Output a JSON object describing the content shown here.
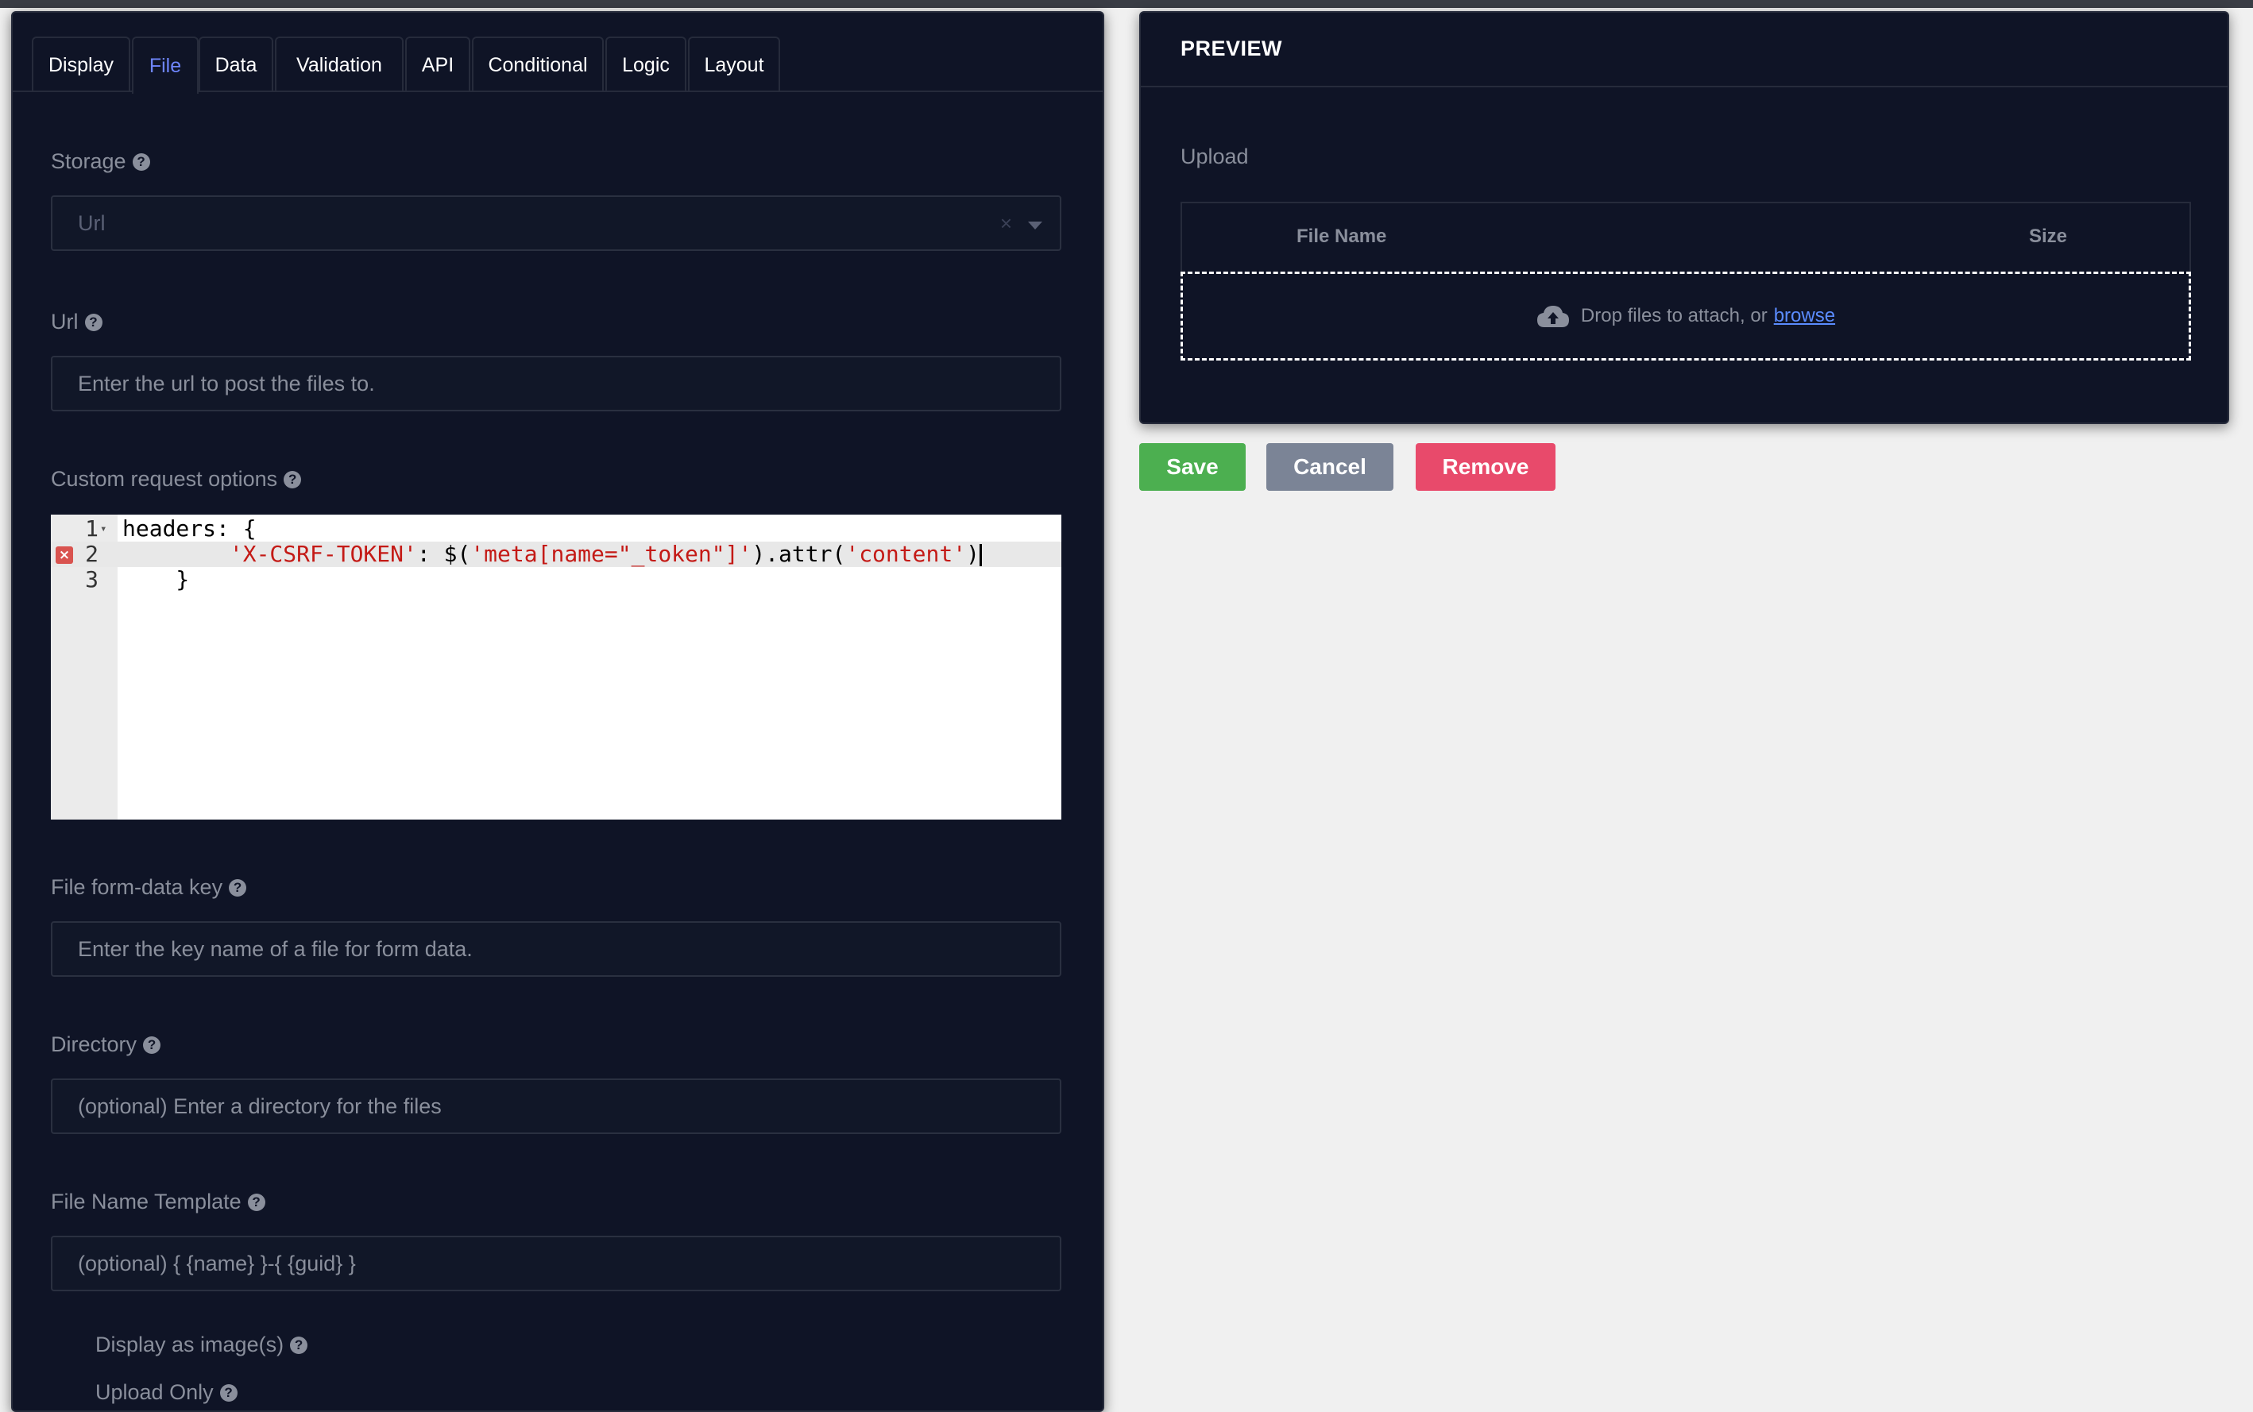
{
  "tabs": [
    {
      "label": "Display"
    },
    {
      "label": "File"
    },
    {
      "label": "Data"
    },
    {
      "label": "Validation"
    },
    {
      "label": "API"
    },
    {
      "label": "Conditional"
    },
    {
      "label": "Logic"
    },
    {
      "label": "Layout"
    }
  ],
  "active_tab": "File",
  "form": {
    "storage": {
      "label": "Storage",
      "value": "Url",
      "clear": "×"
    },
    "url": {
      "label": "Url",
      "placeholder": "Enter the url to post the files to."
    },
    "custom_options": {
      "label": "Custom request options",
      "code_lines": [
        {
          "num": "1",
          "text": "headers: {"
        },
        {
          "num": "2",
          "pre": "        ",
          "str1": "'X-CSRF-TOKEN'",
          "mid": ": $(",
          "str2": "'meta[name=\"_token\"]'",
          "mid2": ").attr(",
          "str3": "'content'",
          "end": ")"
        },
        {
          "num": "3",
          "text": "    }"
        }
      ],
      "error_mark": "×"
    },
    "form_data_key": {
      "label": "File form-data key",
      "placeholder": "Enter the key name of a file for form data."
    },
    "directory": {
      "label": "Directory",
      "placeholder": "(optional) Enter a directory for the files"
    },
    "file_name_template": {
      "label": "File Name Template",
      "placeholder": "(optional) { {name} }-{ {guid} }"
    },
    "display_as_image": {
      "label": "Display as image(s)"
    },
    "upload_only": {
      "label": "Upload Only"
    }
  },
  "help_glyph": "?",
  "preview": {
    "title": "PREVIEW",
    "upload_label": "Upload",
    "columns": {
      "file_name": "File Name",
      "size": "Size"
    },
    "drop_text": "Drop files to attach, or",
    "browse": "browse"
  },
  "buttons": {
    "save": "Save",
    "cancel": "Cancel",
    "remove": "Remove"
  },
  "colors": {
    "panel_bg": "#0f1426",
    "active_tab": "#6f86ff",
    "save": "#4caf50",
    "cancel": "#7b8496",
    "remove": "#e84a6b",
    "link": "#5b8cff"
  }
}
